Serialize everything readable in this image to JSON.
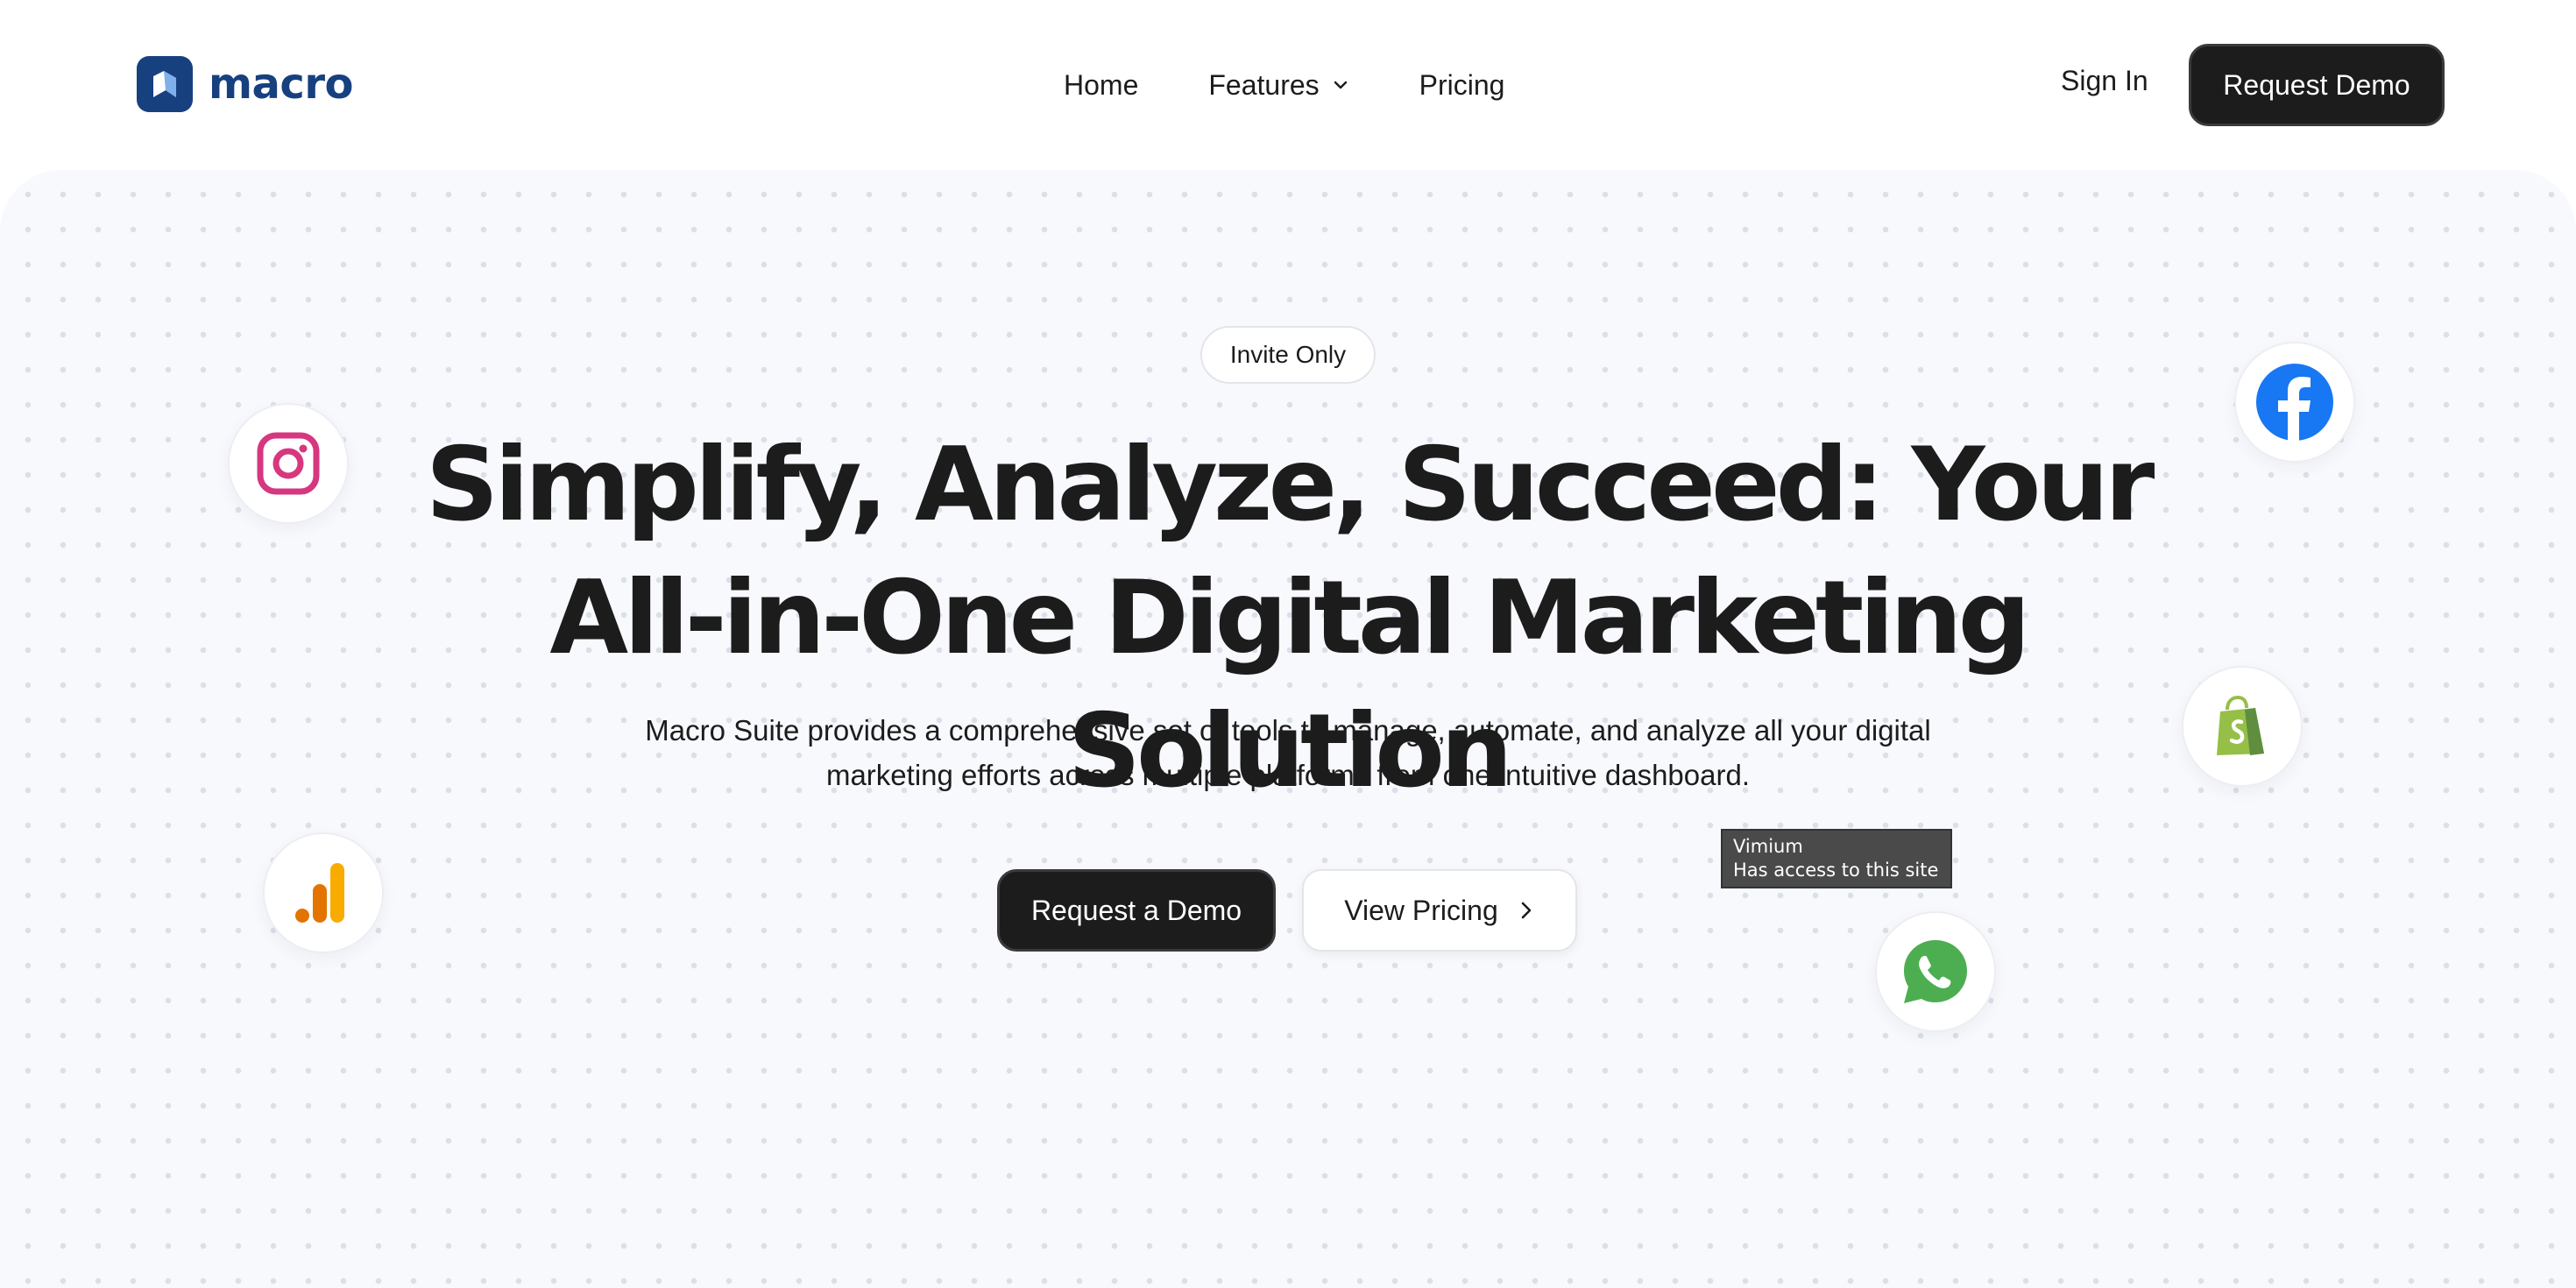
{
  "brand": {
    "name": "macro",
    "color": "#17407f"
  },
  "nav": {
    "links": [
      {
        "label": "Home",
        "icon": null
      },
      {
        "label": "Features",
        "icon": "chevron-down-icon"
      },
      {
        "label": "Pricing",
        "icon": null
      }
    ],
    "sign_in_label": "Sign In",
    "cta_label": "Request Demo"
  },
  "hero": {
    "badge": "Invite Only",
    "headline": "Simplify, Analyze, Succeed: Your All-in-One Digital Marketing Solution",
    "subtitle": "Macro Suite provides a comprehensive set of tools to manage, automate, and analyze all your digital marketing efforts across multiple platforms from one intuitive dashboard.",
    "primary_button": "Request a Demo",
    "secondary_button": "View Pricing",
    "secondary_button_icon": "chevron-right-icon"
  },
  "floating_icons": [
    {
      "name": "instagram-icon",
      "color": "#d6377f"
    },
    {
      "name": "facebook-icon",
      "color": "#1877f2"
    },
    {
      "name": "shopify-icon",
      "color": "#95bf47"
    },
    {
      "name": "google-analytics-icon",
      "color": "#f9ab00"
    },
    {
      "name": "whatsapp-icon",
      "color": "#4cae50"
    }
  ],
  "tooltip": {
    "title": "Vimium",
    "text": "Has access to this site"
  },
  "colors": {
    "dark": "#1c1c1c",
    "hero_bg": "#f8f9fd"
  }
}
